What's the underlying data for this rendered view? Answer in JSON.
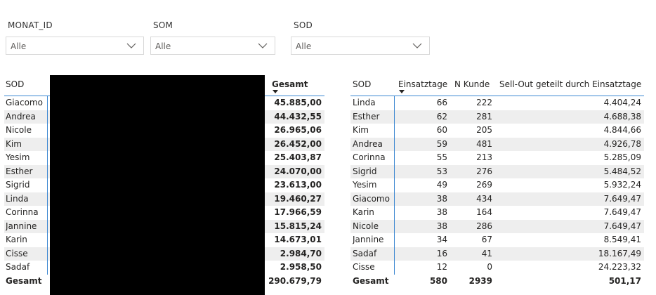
{
  "slicers": [
    {
      "label": "MONAT_ID",
      "value": "Alle"
    },
    {
      "label": "SOM",
      "value": "Alle"
    },
    {
      "label": "SOD",
      "value": "Alle"
    }
  ],
  "left_table": {
    "col_sod": "SOD",
    "col_total": "Gesamt",
    "rows": [
      {
        "name": "Giacomo",
        "total": "45.885,00"
      },
      {
        "name": "Andrea",
        "total": "44.432,55"
      },
      {
        "name": "Nicole",
        "total": "26.965,06"
      },
      {
        "name": "Kim",
        "total": "26.452,00"
      },
      {
        "name": "Yesim",
        "total": "25.403,87"
      },
      {
        "name": "Esther",
        "total": "24.070,00"
      },
      {
        "name": "Sigrid",
        "total": "23.613,00"
      },
      {
        "name": "Linda",
        "total": "19.460,27"
      },
      {
        "name": "Corinna",
        "total": "17.966,59"
      },
      {
        "name": "Jannine",
        "total": "15.815,24"
      },
      {
        "name": "Karin",
        "total": "14.673,01"
      },
      {
        "name": "Cisse",
        "total": "2.984,70"
      },
      {
        "name": "Sadaf",
        "total": "2.958,50"
      }
    ],
    "footer": {
      "name": "Gesamt",
      "total": "290.679,79"
    }
  },
  "right_table": {
    "col_sod": "SOD",
    "col_days": "Einsatztage",
    "col_customers": "N Kunde",
    "col_ratio": "Sell-Out geteilt durch Einsatztage",
    "rows": [
      {
        "name": "Linda",
        "days": "66",
        "customers": "222",
        "ratio": "4.404,24"
      },
      {
        "name": "Esther",
        "days": "62",
        "customers": "281",
        "ratio": "4.688,38"
      },
      {
        "name": "Kim",
        "days": "60",
        "customers": "205",
        "ratio": "4.844,66"
      },
      {
        "name": "Andrea",
        "days": "59",
        "customers": "481",
        "ratio": "4.926,78"
      },
      {
        "name": "Corinna",
        "days": "55",
        "customers": "213",
        "ratio": "5.285,09"
      },
      {
        "name": "Sigrid",
        "days": "53",
        "customers": "276",
        "ratio": "5.484,52"
      },
      {
        "name": "Yesim",
        "days": "49",
        "customers": "269",
        "ratio": "5.932,24"
      },
      {
        "name": "Giacomo",
        "days": "38",
        "customers": "434",
        "ratio": "7.649,47"
      },
      {
        "name": "Karin",
        "days": "38",
        "customers": "164",
        "ratio": "7.649,47"
      },
      {
        "name": "Nicole",
        "days": "38",
        "customers": "286",
        "ratio": "7.649,47"
      },
      {
        "name": "Jannine",
        "days": "34",
        "customers": "67",
        "ratio": "8.549,41"
      },
      {
        "name": "Sadaf",
        "days": "16",
        "customers": "41",
        "ratio": "18.167,49"
      },
      {
        "name": "Cisse",
        "days": "12",
        "customers": "0",
        "ratio": "24.223,32"
      }
    ],
    "footer": {
      "name": "Gesamt",
      "days": "580",
      "customers": "2939",
      "ratio": "501,17"
    }
  }
}
